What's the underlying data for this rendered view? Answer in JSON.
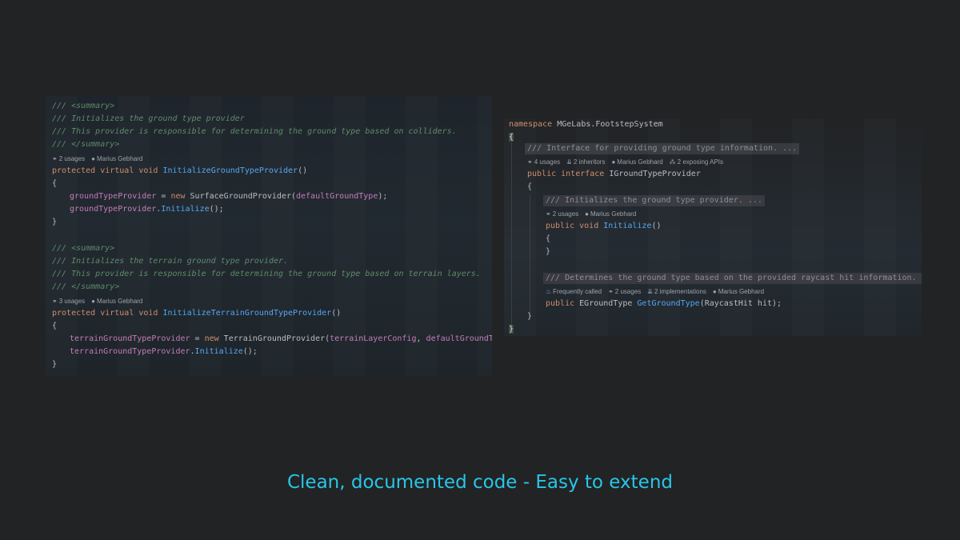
{
  "left": {
    "block1": {
      "doc": [
        "/// <summary>",
        "/// Initializes the ground type provider",
        "/// This provider is responsible for determining the ground type based on colliders.",
        "/// </summary>"
      ],
      "usages": "2 usages",
      "author": "Marius Gebhard",
      "sig_mods": "protected virtual void ",
      "sig_name": "InitializeGroundTypeProvider",
      "sig_end": "()",
      "open": "{",
      "l1_field": "groundTypeProvider",
      "l1_mid": " = ",
      "l1_new": "new ",
      "l1_cls": "SurfaceGroundProvider(",
      "l1_arg": "defaultGroundType",
      "l1_end": ");",
      "l2_field": "groundTypeProvider",
      "l2_dot": ".",
      "l2_fn": "Initialize",
      "l2_end": "();",
      "close": "}"
    },
    "block2": {
      "doc": [
        "/// <summary>",
        "/// Initializes the terrain ground type provider.",
        "/// This provider is responsible for determining the ground type based on terrain layers.",
        "/// </summary>"
      ],
      "usages": "3 usages",
      "author": "Marius Gebhard",
      "sig_mods": "protected virtual void ",
      "sig_name": "InitializeTerrainGroundTypeProvider",
      "sig_end": "()",
      "open": "{",
      "l1_field": "terrainGroundTypeProvider",
      "l1_mid": " = ",
      "l1_new": "new ",
      "l1_cls": "TerrainGroundProvider(",
      "l1_arg1": "terrainLayerConfig",
      "l1_sep": ", ",
      "l1_arg2": "defaultGroundType",
      "l1_end": ");",
      "l2_field": "terrainGroundTypeProvider",
      "l2_dot": ".",
      "l2_fn": "Initialize",
      "l2_end": "();",
      "close": "}"
    }
  },
  "right": {
    "ns_kw": "namespace ",
    "ns_name": "MGeLabs.FootstepSystem",
    "open": "{",
    "iface_doc": "/// Interface for providing ground type information. ...",
    "iface_meta": {
      "usages": "4 usages",
      "inheritors": "2 inheritors",
      "author": "Marius Gebhard",
      "apis": "2 exposing APIs"
    },
    "iface_kw": "public interface ",
    "iface_name": "IGroundTypeProvider",
    "iface_open": "{",
    "m1_doc": "/// Initializes the ground type provider. ...",
    "m1_meta": {
      "usages": "2 usages",
      "author": "Marius Gebhard"
    },
    "m1_kw": "public void ",
    "m1_name": "Initialize",
    "m1_end": "()",
    "m1_open": "{",
    "m1_close": "}",
    "m2_doc": "/// Determines the ground type based on the provided raycast hit information. ...",
    "m2_meta": {
      "freq": "Frequently called",
      "usages": "2 usages",
      "impls": "2 implementations",
      "author": "Marius Gebhard"
    },
    "m2_kw": "public ",
    "m2_type": "EGroundType ",
    "m2_name": "GetGroundType",
    "m2_params": "(RaycastHit hit);",
    "iface_close": "}",
    "close": "}"
  },
  "caption": "Clean, documented code - Easy to extend",
  "colors": {
    "keyword": "#cf8e6d",
    "function": "#56a8f5",
    "field": "#c77dbb",
    "doc": "#5f8c6a",
    "caption": "#29c6e8"
  }
}
